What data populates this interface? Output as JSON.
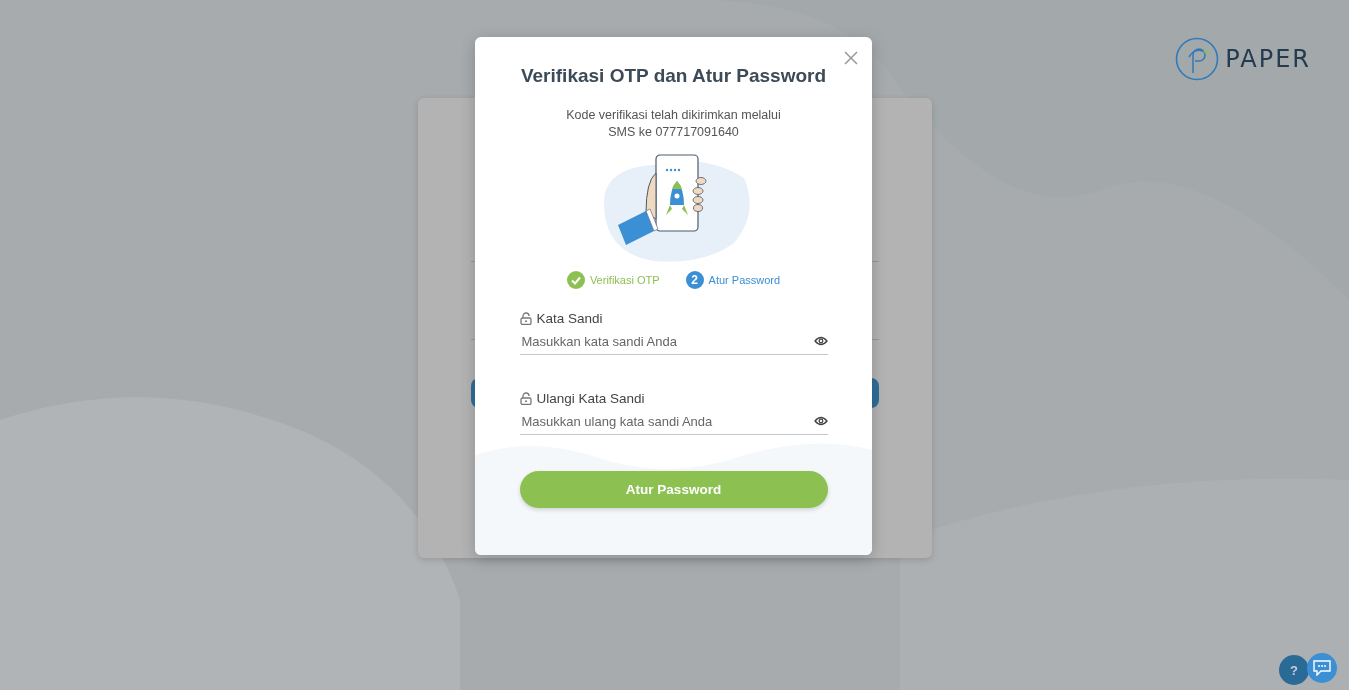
{
  "logo": {
    "text": "PAPER"
  },
  "modal": {
    "title": "Verifikasi OTP dan Atur Password",
    "message_lines": [
      "Kode verifikasi telah dikirimkan melalui",
      "SMS ke 077717091640"
    ],
    "steps": [
      {
        "label": "Verifikasi OTP",
        "completed": true
      },
      {
        "label": "Atur Password",
        "number": "2",
        "completed": false
      }
    ],
    "fields": [
      {
        "label": "Kata Sandi",
        "placeholder": "Masukkan kata sandi Anda"
      },
      {
        "label": "Ulangi Kata Sandi",
        "placeholder": "Masukkan ulang kata sandi Anda"
      }
    ],
    "submit": "Atur Password"
  },
  "help_button": "?"
}
